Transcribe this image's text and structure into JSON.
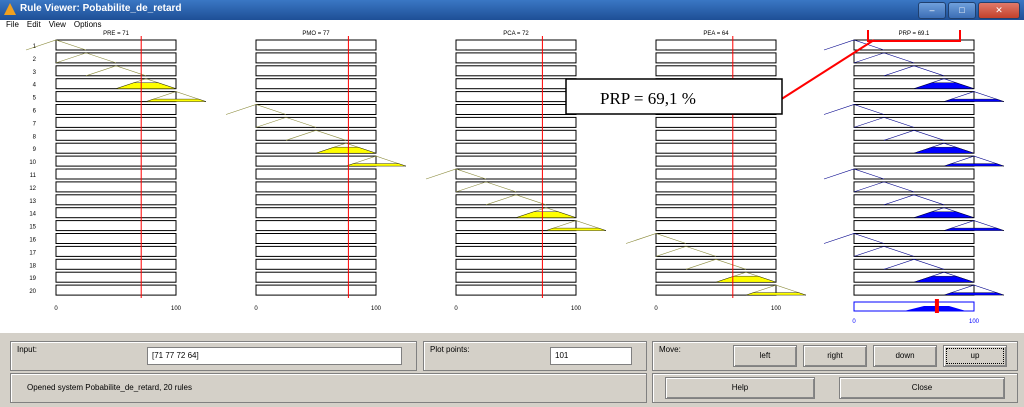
{
  "window": {
    "title": "Rule Viewer: Pobabilite_de_retard"
  },
  "menu": [
    "File",
    "Edit",
    "View",
    "Options"
  ],
  "variables": [
    {
      "label": "PRE = 71",
      "value": 71,
      "range": [
        0,
        100
      ],
      "active_rules": [
        1,
        2,
        3,
        4,
        5
      ],
      "kind": "input"
    },
    {
      "label": "PMO = 77",
      "value": 77,
      "range": [
        0,
        100
      ],
      "active_rules": [
        6,
        7,
        8,
        9,
        10
      ],
      "kind": "input"
    },
    {
      "label": "PCA = 72",
      "value": 72,
      "range": [
        0,
        100
      ],
      "active_rules": [
        11,
        12,
        13,
        14,
        15
      ],
      "kind": "input"
    },
    {
      "label": "PEA = 64",
      "value": 64,
      "range": [
        0,
        100
      ],
      "active_rules": [
        16,
        17,
        18,
        19,
        20
      ],
      "kind": "input"
    },
    {
      "label": "PRP = 69.1",
      "value": 69.1,
      "range": [
        0,
        100
      ],
      "kind": "output"
    }
  ],
  "rules": [
    "1",
    "2",
    "3",
    "4",
    "5",
    "6",
    "7",
    "8",
    "9",
    "10",
    "11",
    "12",
    "13",
    "14",
    "15",
    "16",
    "17",
    "18",
    "19",
    "20"
  ],
  "axis": {
    "min": "0",
    "max": "100"
  },
  "annotation": {
    "text": "PRP = 69,1 %"
  },
  "colors": {
    "input_fill": "#ffff00",
    "output_fill": "#0000ff",
    "marker": "#ff0000",
    "highlight": "#ff0000"
  },
  "input_panel": {
    "label": "Input:",
    "value": "[71 77 72 64]"
  },
  "plot_points": {
    "label": "Plot points:",
    "value": "101"
  },
  "move": {
    "label": "Move:",
    "buttons": [
      "left",
      "right",
      "down",
      "up"
    ]
  },
  "status": {
    "text": "Opened system Pobabilite_de_retard, 20 rules"
  },
  "actions": {
    "help": "Help",
    "close": "Close"
  }
}
